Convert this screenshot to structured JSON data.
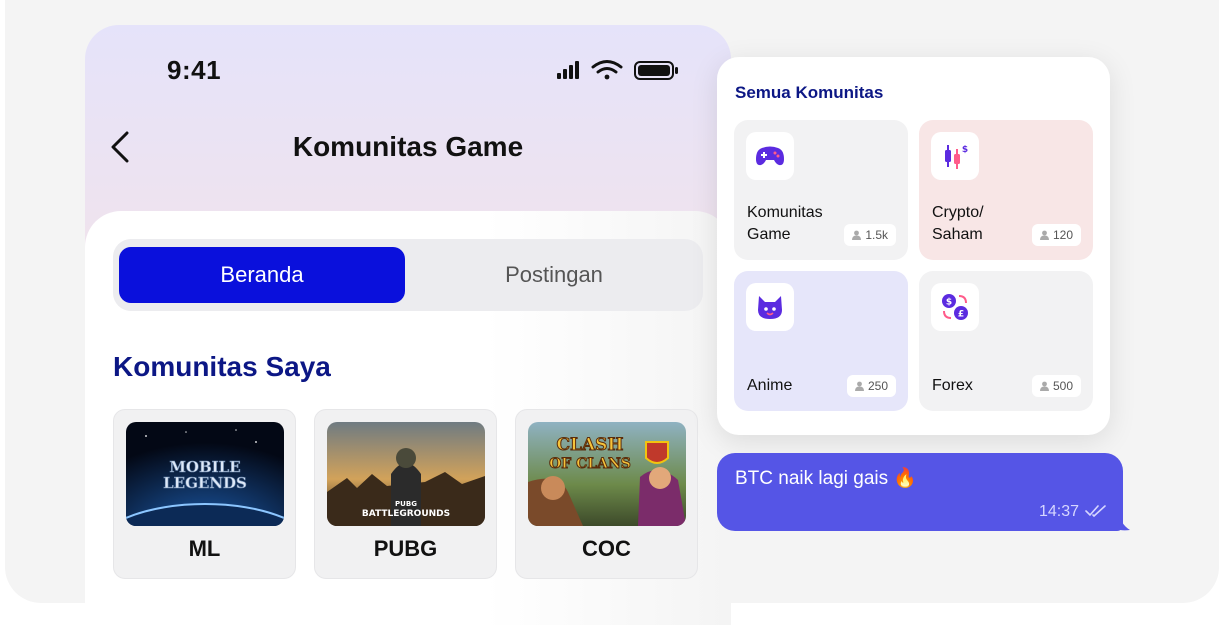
{
  "status_bar": {
    "time": "9:41"
  },
  "header": {
    "title": "Komunitas Game"
  },
  "tabs": [
    {
      "label": "Beranda",
      "active": true
    },
    {
      "label": "Postingan",
      "active": false
    }
  ],
  "my_communities": {
    "title": "Komunitas Saya",
    "items": [
      {
        "label": "ML",
        "art_text": "MOBILE LEGENDS"
      },
      {
        "label": "PUBG",
        "art_text": "PUBG BATTLEGROUNDS"
      },
      {
        "label": "COC",
        "art_text": "CLASH OF CLANS"
      }
    ]
  },
  "all_communities": {
    "title": "Semua Komunitas",
    "tiles": [
      {
        "name": "Komunitas Game",
        "count": "1.5k",
        "icon": "gamepad-icon",
        "bg": "#f2f2f3"
      },
      {
        "name": "Crypto/ Saham",
        "count": "120",
        "icon": "candlestick-chart-icon",
        "bg": "#f8e6e6"
      },
      {
        "name": "Anime",
        "count": "250",
        "icon": "cat-face-icon",
        "bg": "#e6e6fa"
      },
      {
        "name": "Forex",
        "count": "500",
        "icon": "currency-exchange-icon",
        "bg": "#f2f2f3"
      }
    ]
  },
  "chat_message": {
    "text": "BTC naik lagi gais 🔥",
    "time": "14:37",
    "status": "read"
  },
  "colors": {
    "primary": "#0a10dc",
    "heading": "#0c1785",
    "bubble": "#5555e6",
    "icon_purple": "#5b2be0"
  }
}
